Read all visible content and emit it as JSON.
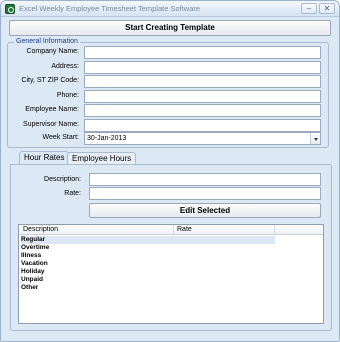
{
  "window": {
    "title": "Excel Weekly Employee Timesheet Template Software",
    "controls": {
      "minimize": "–",
      "close": "✕"
    }
  },
  "toolbar": {
    "start_button": "Start Creating Template"
  },
  "general": {
    "title": "General Information",
    "fields": [
      {
        "label": "Company Name:",
        "value": ""
      },
      {
        "label": "Address:",
        "value": ""
      },
      {
        "label": "City, ST  ZIP Code:",
        "value": ""
      },
      {
        "label": "Phone:",
        "value": ""
      },
      {
        "label": "Employee Name:",
        "value": ""
      },
      {
        "label": "Supervisor Name:",
        "value": ""
      }
    ],
    "week_start": {
      "label": "Week Start:",
      "value": "30-Jan-2013"
    }
  },
  "tabs": [
    {
      "label": "Hour Rates",
      "active": true
    },
    {
      "label": "Employee Hours",
      "active": false
    }
  ],
  "rates": {
    "description_label": "Description:",
    "description_value": "",
    "rate_label": "Rate:",
    "rate_value": "",
    "edit_button": "Edit Selected",
    "columns": [
      "Description",
      "Rate"
    ],
    "rows": [
      {
        "description": "Regular",
        "rate": "",
        "selected": true
      },
      {
        "description": "Overtime",
        "rate": "",
        "selected": false
      },
      {
        "description": "Illness",
        "rate": "",
        "selected": false
      },
      {
        "description": "Vacation",
        "rate": "",
        "selected": false
      },
      {
        "description": "Holiday",
        "rate": "",
        "selected": false
      },
      {
        "description": "Unpaid",
        "rate": "",
        "selected": false
      },
      {
        "description": "Other",
        "rate": "",
        "selected": false
      }
    ]
  },
  "colors": {
    "accent": "#1a3f8c",
    "background": "#dde8f5"
  }
}
